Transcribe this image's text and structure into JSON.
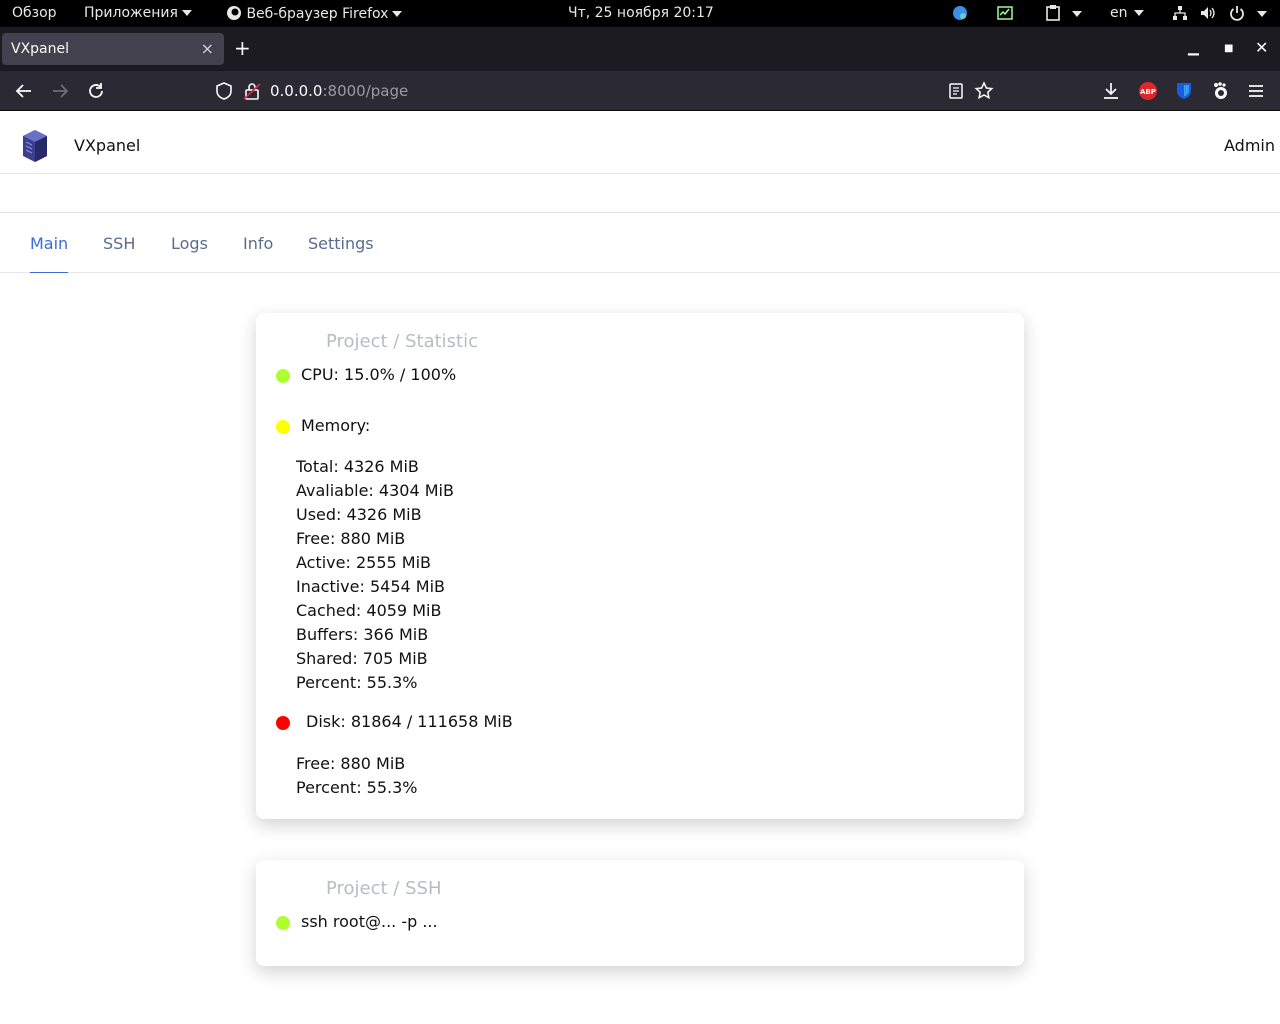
{
  "system_bar": {
    "overview": "Обзор",
    "apps": "Приложения",
    "browser": "Веб-браузер Firefox",
    "clock": "Чт, 25 ноября  20:17",
    "lang": "en"
  },
  "browser": {
    "tab_title": "VXpanel",
    "url_host": "0.0.0.0",
    "url_rest": ":8000/page"
  },
  "app": {
    "name": "VXpanel",
    "user": "Admin",
    "tabs": [
      "Main",
      "SSH",
      "Logs",
      "Info",
      "Settings"
    ],
    "active_tab": "Main"
  },
  "statistic": {
    "title": "Project / Statistic",
    "cpu": "CPU: 15.0% / 100%",
    "cpu_color": "#adff2f",
    "memory_label": "Memory:",
    "memory_color": "#ffff00",
    "memory": [
      "Total: 4326 MiB",
      "Avaliable: 4304 MiB",
      "Used: 4326 MiB",
      "Free: 880 MiB",
      "Active: 2555 MiB",
      "Inactive: 5454 MiB",
      "Cached: 4059 MiB",
      "Buffers: 366 MiB",
      "Shared: 705 MiB",
      "Percent: 55.3%"
    ],
    "disk": "Disk: 81864 / 111658 MiB",
    "disk_color": "#ff0000",
    "disk_details": [
      "Free: 880 MiB",
      "Percent: 55.3%"
    ]
  },
  "ssh": {
    "title": "Project / SSH",
    "command": "ssh root@... -p ...",
    "status_color": "#adff2f"
  }
}
